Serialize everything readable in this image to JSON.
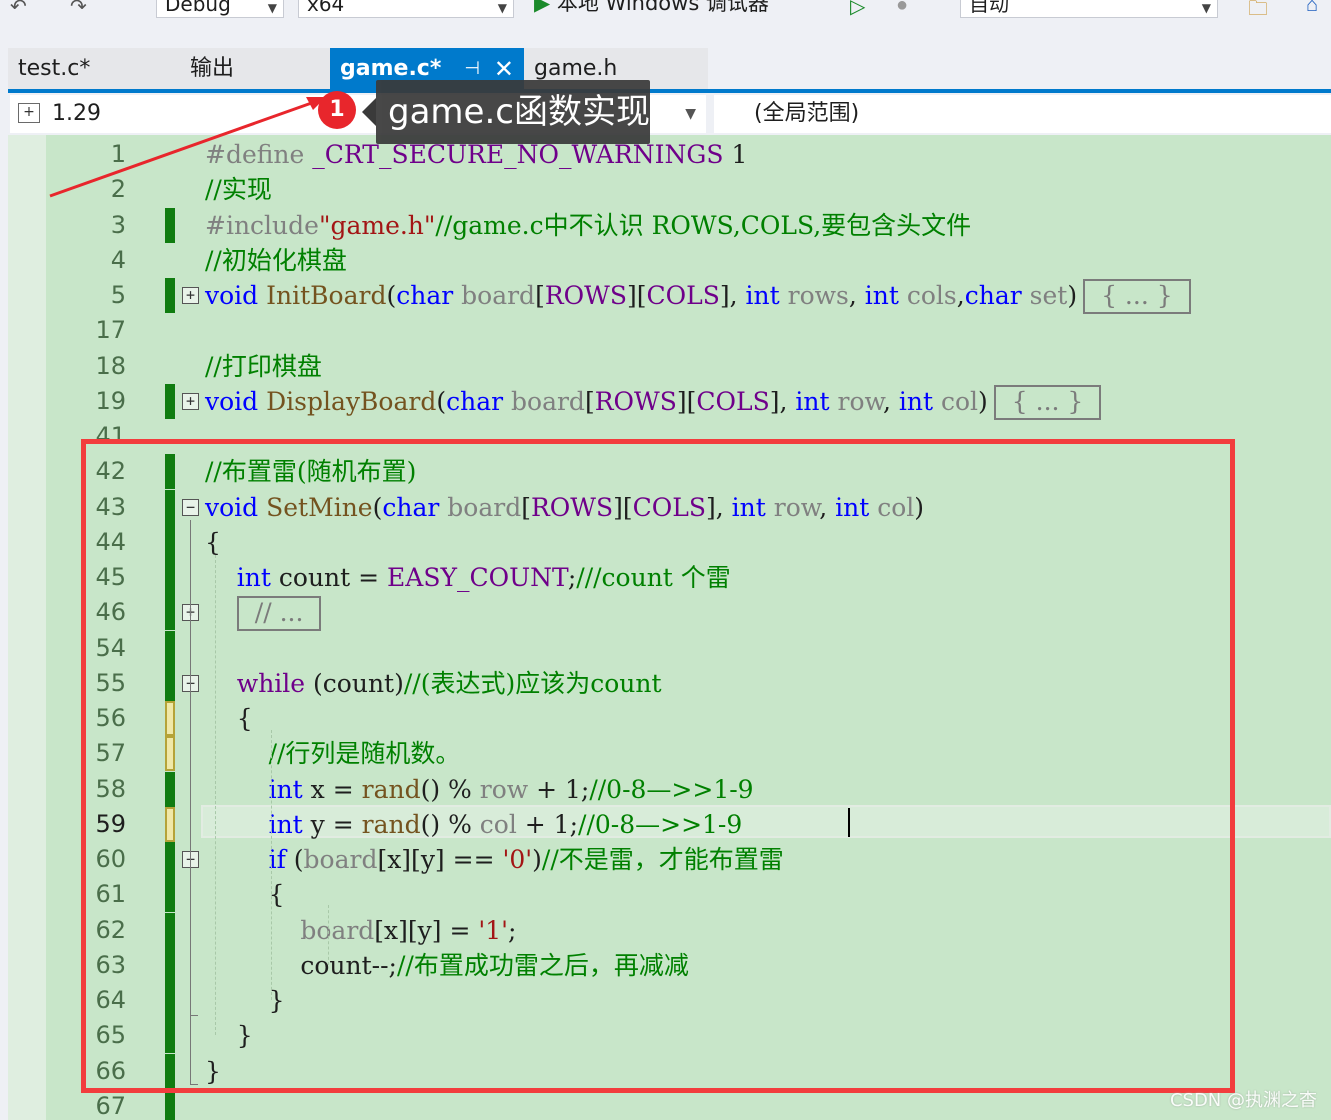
{
  "toolbar": {
    "config": "Debug",
    "platform": "x64",
    "run_label": "本地 Windows 调试器",
    "mode": "自动"
  },
  "tabs": [
    {
      "label": "test.c*",
      "active": false
    },
    {
      "label": "输出",
      "active": false
    },
    {
      "label": "game.c*",
      "active": true
    },
    {
      "label": "game.h",
      "active": false
    }
  ],
  "navbar": {
    "project": "1.29",
    "scope": "(全局范围)"
  },
  "annotation": {
    "badge": "1",
    "callout": "game.c函数实现",
    "box_color": "#f23d3d"
  },
  "colors": {
    "editor_bg": "#c8e6c9",
    "accent": "#007acc",
    "change_saved": "#107c10",
    "change_unsaved": "#f0e8a8"
  },
  "editor": {
    "current_line": "59",
    "lines": [
      {
        "n": "1",
        "tokens": [
          [
            "pp",
            "#define "
          ],
          [
            "mac",
            "_CRT_SECURE_NO_WARNINGS"
          ],
          [
            "id",
            " 1"
          ]
        ]
      },
      {
        "n": "2",
        "tokens": [
          [
            "cm",
            "//实现"
          ]
        ]
      },
      {
        "n": "3",
        "tokens": [
          [
            "pp",
            "#include"
          ],
          [
            "str",
            "\"game.h\""
          ],
          [
            "cm",
            "//game.c中不认识 ROWS,COLS,要包含头文件"
          ]
        ]
      },
      {
        "n": "4",
        "tokens": [
          [
            "cm",
            "//初始化棋盘"
          ]
        ]
      },
      {
        "n": "5",
        "tokens": [
          [
            "kw",
            "void"
          ],
          [
            "id",
            " "
          ],
          [
            "fn",
            "InitBoard"
          ],
          [
            "id",
            "("
          ],
          [
            "kw",
            "char"
          ],
          [
            "id",
            " "
          ],
          [
            "pm",
            "board"
          ],
          [
            "id",
            "["
          ],
          [
            "mac",
            "ROWS"
          ],
          [
            "id",
            "]["
          ],
          [
            "mac",
            "COLS"
          ],
          [
            "id",
            "], "
          ],
          [
            "kw",
            "int"
          ],
          [
            "id",
            " "
          ],
          [
            "pm",
            "rows"
          ],
          [
            "id",
            ", "
          ],
          [
            "kw",
            "int"
          ],
          [
            "id",
            " "
          ],
          [
            "pm",
            "cols"
          ],
          [
            "id",
            ","
          ],
          [
            "kw",
            "char"
          ],
          [
            "id",
            " "
          ],
          [
            "pm",
            "set"
          ],
          [
            "id",
            ")"
          ]
        ],
        "collapsed": "{ ... }"
      },
      {
        "n": "17",
        "tokens": []
      },
      {
        "n": "18",
        "tokens": [
          [
            "cm",
            "//打印棋盘"
          ]
        ]
      },
      {
        "n": "19",
        "tokens": [
          [
            "kw",
            "void"
          ],
          [
            "id",
            " "
          ],
          [
            "fn",
            "DisplayBoard"
          ],
          [
            "id",
            "("
          ],
          [
            "kw",
            "char"
          ],
          [
            "id",
            " "
          ],
          [
            "pm",
            "board"
          ],
          [
            "id",
            "["
          ],
          [
            "mac",
            "ROWS"
          ],
          [
            "id",
            "]["
          ],
          [
            "mac",
            "COLS"
          ],
          [
            "id",
            "], "
          ],
          [
            "kw",
            "int"
          ],
          [
            "id",
            " "
          ],
          [
            "pm",
            "row"
          ],
          [
            "id",
            ", "
          ],
          [
            "kw",
            "int"
          ],
          [
            "id",
            " "
          ],
          [
            "pm",
            "col"
          ],
          [
            "id",
            ")"
          ]
        ],
        "collapsed": "{ ... }"
      },
      {
        "n": "41",
        "tokens": []
      },
      {
        "n": "42",
        "tokens": [
          [
            "cm",
            "//布置雷(随机布置)"
          ]
        ]
      },
      {
        "n": "43",
        "tokens": [
          [
            "kw",
            "void"
          ],
          [
            "id",
            " "
          ],
          [
            "fn",
            "SetMine"
          ],
          [
            "id",
            "("
          ],
          [
            "kw",
            "char"
          ],
          [
            "id",
            " "
          ],
          [
            "pm",
            "board"
          ],
          [
            "id",
            "["
          ],
          [
            "mac",
            "ROWS"
          ],
          [
            "id",
            "]["
          ],
          [
            "mac",
            "COLS"
          ],
          [
            "id",
            "], "
          ],
          [
            "kw",
            "int"
          ],
          [
            "id",
            " "
          ],
          [
            "pm",
            "row"
          ],
          [
            "id",
            ", "
          ],
          [
            "kw",
            "int"
          ],
          [
            "id",
            " "
          ],
          [
            "pm",
            "col"
          ],
          [
            "id",
            ")"
          ]
        ]
      },
      {
        "n": "44",
        "tokens": [
          [
            "id",
            "{"
          ]
        ]
      },
      {
        "n": "45",
        "tokens": [
          [
            "id",
            "    "
          ],
          [
            "kw",
            "int"
          ],
          [
            "id",
            " count = "
          ],
          [
            "mac",
            "EASY_COUNT"
          ],
          [
            "id",
            ";"
          ],
          [
            "cm",
            "///count 个雷"
          ]
        ]
      },
      {
        "n": "46",
        "tokens": [
          [
            "id",
            "    "
          ]
        ],
        "collapsed": "// ..."
      },
      {
        "n": "54",
        "tokens": []
      },
      {
        "n": "55",
        "tokens": [
          [
            "id",
            "    "
          ],
          [
            "mac",
            "while"
          ],
          [
            "id",
            " (count)"
          ],
          [
            "cm",
            "//(表达式)应该为count"
          ]
        ]
      },
      {
        "n": "56",
        "tokens": [
          [
            "id",
            "    {"
          ]
        ]
      },
      {
        "n": "57",
        "tokens": [
          [
            "id",
            "        "
          ],
          [
            "cm",
            "//行列是随机数。"
          ]
        ]
      },
      {
        "n": "58",
        "tokens": [
          [
            "id",
            "        "
          ],
          [
            "kw",
            "int"
          ],
          [
            "id",
            " x = "
          ],
          [
            "fn",
            "rand"
          ],
          [
            "id",
            "() % "
          ],
          [
            "pm",
            "row"
          ],
          [
            "id",
            " + 1;"
          ],
          [
            "cm",
            "//0-8—>>1-9"
          ]
        ]
      },
      {
        "n": "59",
        "tokens": [
          [
            "id",
            "        "
          ],
          [
            "kw",
            "int"
          ],
          [
            "id",
            " y = "
          ],
          [
            "fn",
            "rand"
          ],
          [
            "id",
            "() % "
          ],
          [
            "pm",
            "col"
          ],
          [
            "id",
            " + 1;"
          ],
          [
            "cm",
            "//0-8—>>1-9"
          ]
        ]
      },
      {
        "n": "60",
        "tokens": [
          [
            "id",
            "        "
          ],
          [
            "kw",
            "if"
          ],
          [
            "id",
            " ("
          ],
          [
            "pm",
            "board"
          ],
          [
            "id",
            "[x][y] == "
          ],
          [
            "str",
            "'0'"
          ],
          [
            "id",
            ")"
          ],
          [
            "cm",
            "//不是雷，才能布置雷"
          ]
        ]
      },
      {
        "n": "61",
        "tokens": [
          [
            "id",
            "        {"
          ]
        ]
      },
      {
        "n": "62",
        "tokens": [
          [
            "id",
            "            "
          ],
          [
            "pm",
            "board"
          ],
          [
            "id",
            "[x][y] = "
          ],
          [
            "str",
            "'1'"
          ],
          [
            "id",
            ";"
          ]
        ]
      },
      {
        "n": "63",
        "tokens": [
          [
            "id",
            "            count--;"
          ],
          [
            "cm",
            "//布置成功雷之后，再减减"
          ]
        ]
      },
      {
        "n": "64",
        "tokens": [
          [
            "id",
            "        }"
          ]
        ]
      },
      {
        "n": "65",
        "tokens": [
          [
            "id",
            "    }"
          ]
        ]
      },
      {
        "n": "66",
        "tokens": [
          [
            "id",
            "}"
          ]
        ]
      },
      {
        "n": "67",
        "tokens": []
      }
    ]
  },
  "watermark": "CSDN @执渊之杳"
}
